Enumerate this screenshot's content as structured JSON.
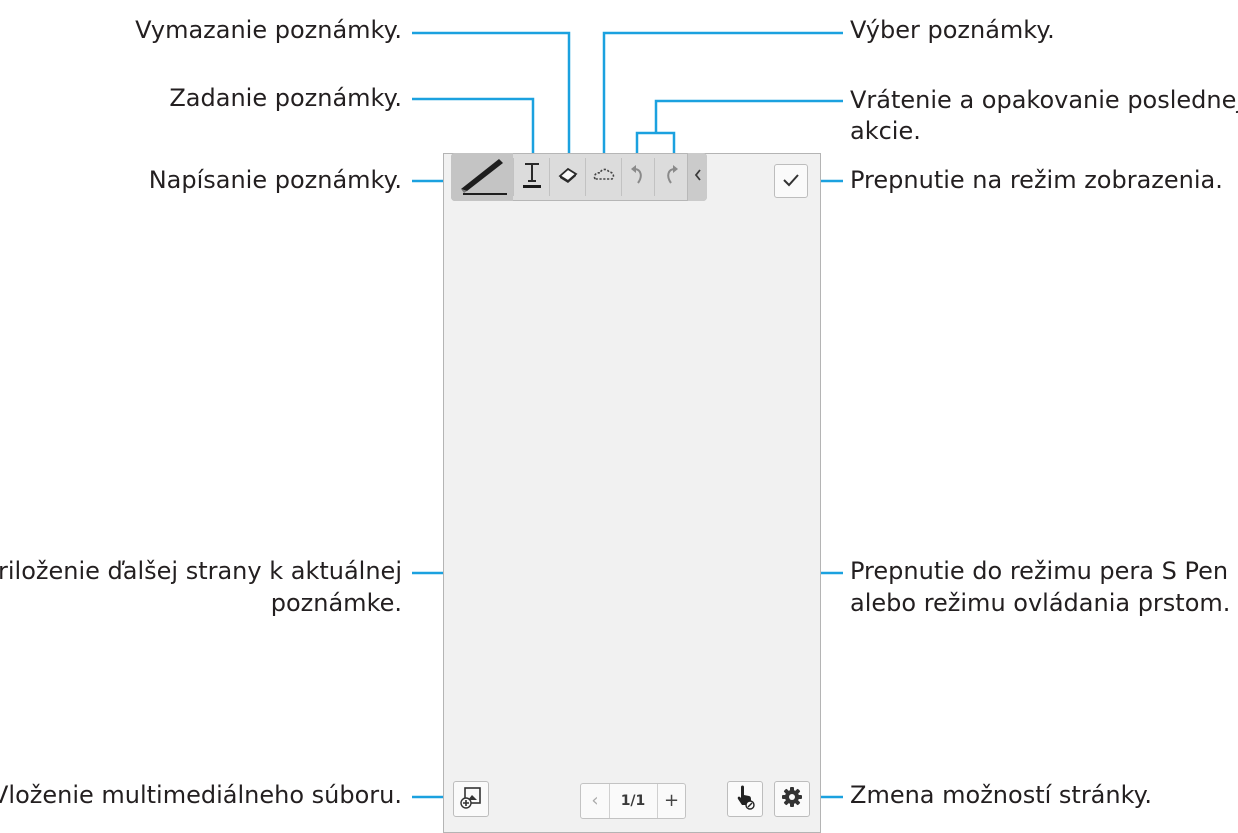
{
  "labels": {
    "delete_note": "Vymazanie poznámky.",
    "enter_note": "Zadanie poznámky.",
    "write_note": "Napísanie poznámky.",
    "select_note": "Výber poznámky.",
    "undo_redo_line1": "Vrátenie a opakovanie poslednej",
    "undo_redo_line2": "akcie.",
    "view_mode": "Prepnutie na režim zobrazenia.",
    "attach_page_line1": "Priloženie ďalšej strany k aktuálnej",
    "attach_page_line2": "poznámke.",
    "pen_mode_line1": "Prepnutie do režimu pera S Pen",
    "pen_mode_line2": "alebo režimu ovládania prstom.",
    "insert_media": "Vloženie multimediálneho súboru.",
    "page_options": "Zmena možností stránky."
  },
  "pager": {
    "page_indicator": "1/1",
    "prev_symbol": "‹",
    "add_symbol": "+"
  },
  "colors": {
    "callout_line": "#1ba1df",
    "text": "#231f20",
    "toolbar_bg": "#dcdcdc",
    "canvas_bg": "#f1f1f1"
  },
  "icons": [
    "pen-icon",
    "text-icon",
    "eraser-icon",
    "lasso-icon",
    "undo-icon",
    "redo-icon",
    "collapse-chevron-icon",
    "check-icon",
    "insert-media-icon",
    "finger-pen-icon",
    "settings-gear-icon"
  ]
}
